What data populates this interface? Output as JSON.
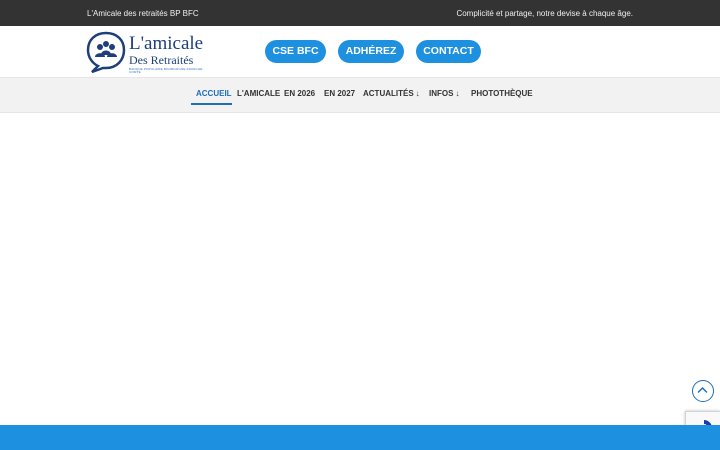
{
  "topbar": {
    "left_text": "L'Amicale des retraités BP BFC",
    "right_text": "Complicité et partage, notre devise à chaque âge."
  },
  "logo": {
    "line1": "L'amicale",
    "line2": "Des Retraités",
    "tagline": "BANQUE POPULAIRE BOURGOGNE FRANCHE-COMTÉ",
    "color": "#1f3f7a"
  },
  "header_buttons": {
    "cse": "CSE BFC",
    "adherez": "ADHÉREZ",
    "contact": "CONTACT"
  },
  "nav": {
    "items": [
      {
        "label": "ACCUEIL",
        "active": true
      },
      {
        "label": "L'AMICALE"
      },
      {
        "label": "EN 2026"
      },
      {
        "label": "EN 2027"
      },
      {
        "label": "ACTUALITÉS",
        "dropdown": true
      },
      {
        "label": "INFOS",
        "dropdown": true
      },
      {
        "label": "PHOTOTHÈQUE"
      }
    ],
    "arrow": "↓"
  },
  "colors": {
    "accent": "#1e90e0",
    "nav_active": "#1e6fb8",
    "topbar_bg": "#333333"
  },
  "icons": {
    "scroll_top": "chevron-up-icon",
    "recaptcha": "recaptcha-icon"
  }
}
